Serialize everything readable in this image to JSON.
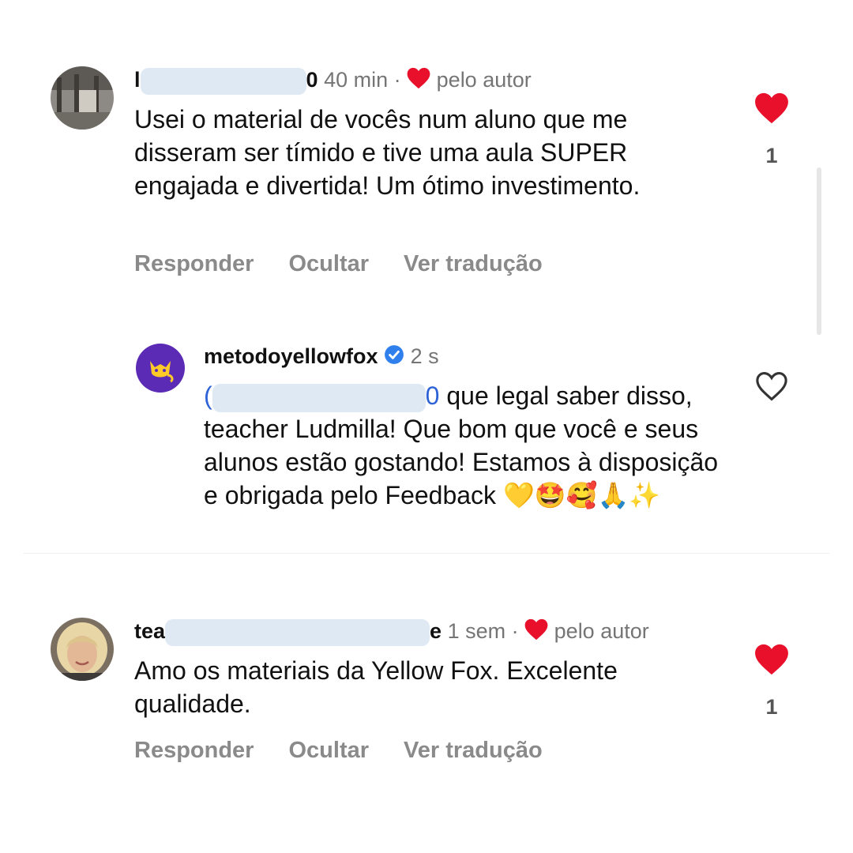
{
  "comment1": {
    "username_start": "l",
    "username_end": "0",
    "time": "40 min",
    "separator": "·",
    "author_label": "pelo autor",
    "text": "Usei o material de vocês num aluno que me disseram ser tímido e tive uma aula SUPER engajada e divertida! Um ótimo investimento.",
    "likes": "1",
    "liked": true
  },
  "reply1": {
    "username": "metodoyellowfox",
    "verified": true,
    "time": "2 s",
    "mention_start": "(",
    "mention_end": "0",
    "text": " que legal saber disso, teacher Ludmilla! Que bom que você e seus alunos estão gostando! Estamos à disposição e obrigada pelo Feedback ",
    "emojis": "💛🤩🥰🙏✨",
    "liked": false
  },
  "comment2": {
    "username_start": "tea",
    "username_end": "e",
    "time": "1 sem",
    "separator": "·",
    "author_label": "pelo autor",
    "text": "Amo os materiais da Yellow Fox. Excelente qualidade.",
    "likes": "1",
    "liked": true
  },
  "actions": {
    "reply": "Responder",
    "hide": "Ocultar",
    "translate": "Ver tradução"
  },
  "colors": {
    "heart_red": "#e8102b",
    "mention_blue": "#2d63d6",
    "verified_blue": "#2f80ed",
    "brand_purple": "#5b2bb5",
    "brand_yellow": "#ffc928",
    "muted_gray": "#8a8a8a"
  }
}
